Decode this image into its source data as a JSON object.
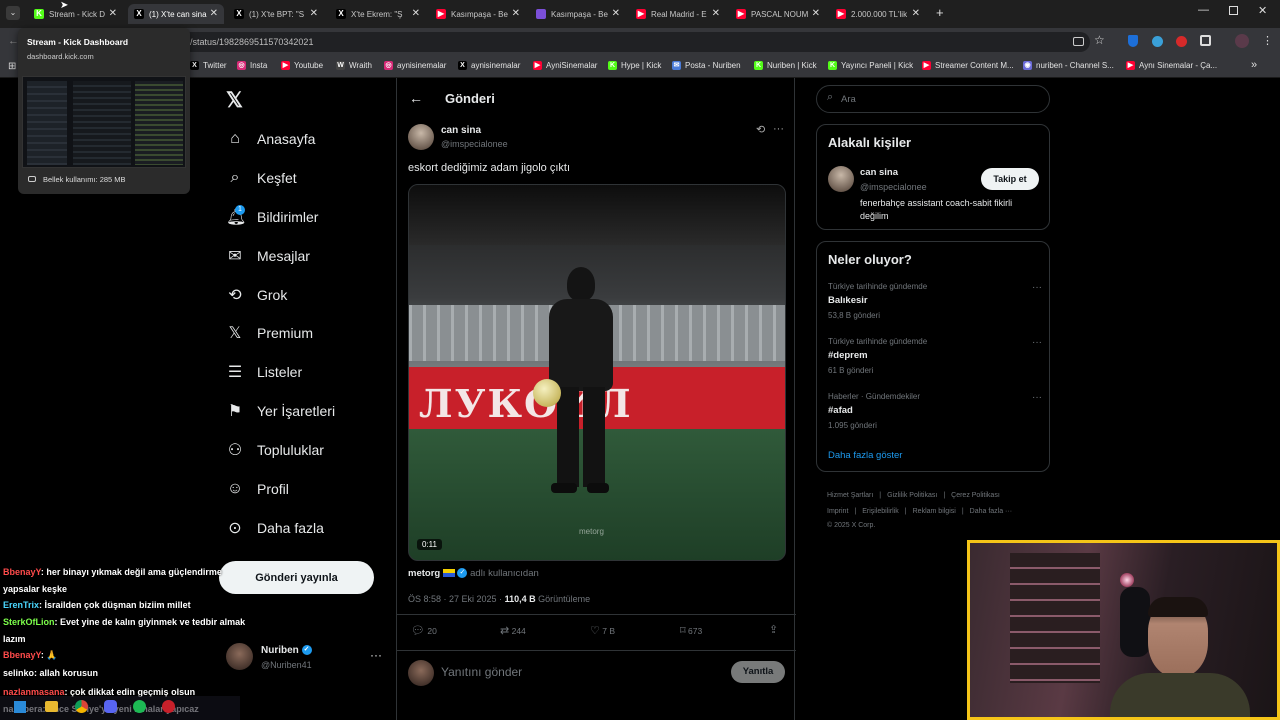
{
  "browser": {
    "tabs": [
      {
        "label": "Stream - Kick D",
        "fav_color": "#53fc18",
        "fav_text": "K"
      },
      {
        "label": "(1) X'te can sina",
        "fav_color": "#000000",
        "fav_text": "X"
      },
      {
        "label": "(1) X'te BPT: \"S",
        "fav_color": "#000000",
        "fav_text": "X"
      },
      {
        "label": "X'te Ekrem: \"Ş",
        "fav_color": "#000000",
        "fav_text": "X"
      },
      {
        "label": "Kasımpaşa - Be",
        "fav_color": "#ff0033",
        "fav_text": "▶"
      },
      {
        "label": "Kasımpaşa - Be",
        "fav_color": "#7b4fd8",
        "fav_text": ""
      },
      {
        "label": "Real Madrid - E",
        "fav_color": "#ff0033",
        "fav_text": "▶"
      },
      {
        "label": "PASCAL NOUM",
        "fav_color": "#ff0033",
        "fav_text": "▶"
      },
      {
        "label": "2.000.000 TL'lik",
        "fav_color": "#ff0033",
        "fav_text": "▶"
      }
    ],
    "new_tab": "+",
    "url": "/status/1982869511570342021",
    "hover_card": {
      "title": "Stream - Kick Dashboard",
      "domain": "dashboard.kick.com",
      "memory": "Bellek kullanımı: 285 MB"
    },
    "bookmarks": [
      {
        "label": "Twitter",
        "color": "#000000",
        "icon": "X"
      },
      {
        "label": "Insta",
        "color": "#d62976",
        "icon": "◎"
      },
      {
        "label": "Youtube",
        "color": "#ff0033",
        "icon": "▶"
      },
      {
        "label": "Wraith",
        "color": "#444444",
        "icon": "W"
      },
      {
        "label": "aynisinemalar",
        "color": "#d62976",
        "icon": "◎"
      },
      {
        "label": "aynisinemalar",
        "color": "#000000",
        "icon": "X"
      },
      {
        "label": "AyniSinemalar",
        "color": "#ff0033",
        "icon": "▶"
      },
      {
        "label": "Hype | Kick",
        "color": "#53fc18",
        "icon": "K"
      },
      {
        "label": "Posta - Nuriben",
        "color": "#4a7bd8",
        "icon": "✉"
      },
      {
        "label": "Nuriben | Kick",
        "color": "#53fc18",
        "icon": "K"
      },
      {
        "label": "Yayıncı Paneli | Kick",
        "color": "#53fc18",
        "icon": "K"
      },
      {
        "label": "Streamer Content M...",
        "color": "#ff0033",
        "icon": "▶"
      },
      {
        "label": "nuriben - Channel S...",
        "color": "#6b6bd8",
        "icon": "◉"
      },
      {
        "label": "Aynı Sinemalar - Ça...",
        "color": "#ff0033",
        "icon": "▶"
      }
    ]
  },
  "nav": {
    "items": [
      "Anasayfa",
      "Keşfet",
      "Bildirimler",
      "Mesajlar",
      "Grok",
      "Premium",
      "Listeler",
      "Yer İşaretleri",
      "Topluluklar",
      "Profil",
      "Daha fazla"
    ],
    "notification_count": "1",
    "post_button": "Gönderi yayınla",
    "account_name": "Nuriben",
    "account_handle": "@Nuriben41"
  },
  "post": {
    "header": "Gönderi",
    "author_name": "can sina",
    "author_handle": "@imspecialonee",
    "text": "eskort dediğimiz adam jigolo çıktı",
    "video_duration": "0:11",
    "video_banner": "ЛУКОЙЛ",
    "video_watermark": "metorg",
    "source_user": "metorg",
    "source_label": "adlı kullanıcıdan",
    "time": "ÖS 8:58 · 27 Eki 2025 ·",
    "views": "110,4 B",
    "views_label": "Görüntüleme",
    "replies": "20",
    "reposts": "244",
    "likes": "7 B",
    "bookmarks": "673",
    "reply_placeholder": "Yanıtını gönder",
    "reply_button": "Yanıtla"
  },
  "sidebar": {
    "search_placeholder": "Ara",
    "related_title": "Alakalı kişiler",
    "related_name": "can sina",
    "related_handle": "@imspecialonee",
    "related_bio": "fenerbahçe assistant coach-sabit fikirli değilim",
    "follow_button": "Takip et",
    "trends_title": "Neler oluyor?",
    "trends": [
      {
        "meta": "Türkiye tarihinde gündemde",
        "name": "Balıkesir",
        "count": "53,8 B gönderi"
      },
      {
        "meta": "Türkiye tarihinde gündemde",
        "name": "#deprem",
        "count": "61 B gönderi"
      },
      {
        "meta": "Haberler · Gündemdekiler",
        "name": "#afad",
        "count": "1.095 gönderi"
      }
    ],
    "show_more": "Daha fazla göster",
    "footer_line1": [
      "Hizmet Şartları",
      "Gizlilik Politikası",
      "Çerez Politikası"
    ],
    "footer_line2": [
      "Imprint",
      "Erişilebilirlik",
      "Reklam bilgisi",
      "Daha fazla ···"
    ],
    "copyright": "© 2025 X Corp."
  },
  "chat": [
    {
      "user": "BbenayY",
      "color": "#ff4b4b",
      "msg": ": her binayı yıkmak değil ama güçlendirme yapsalar keşke"
    },
    {
      "user": "ErenTrix",
      "color": "#4bd8ff",
      "msg": ": İsrailden çok düşman biziim millet"
    },
    {
      "user": "SterkOfLion",
      "color": "#7dff4b",
      "msg": ": Evet yine de kalın giyinmek ve tedbir almak lazım"
    },
    {
      "user": "BbenayY",
      "color": "#ff4b4b",
      "msg": ": 🙏"
    },
    {
      "user": "selinko",
      "color": "#ffffff",
      "msg": ": allah korusun"
    },
    {
      "user": "nazlanmasana",
      "color": "#ff4b4b",
      "msg": ": çok dikkat edin geçmiş olsun"
    },
    {
      "user": "nalixbera",
      "color": "#ffffff",
      "msg": ": önce Suriye'ye yeni binalar yapıcaz"
    }
  ]
}
